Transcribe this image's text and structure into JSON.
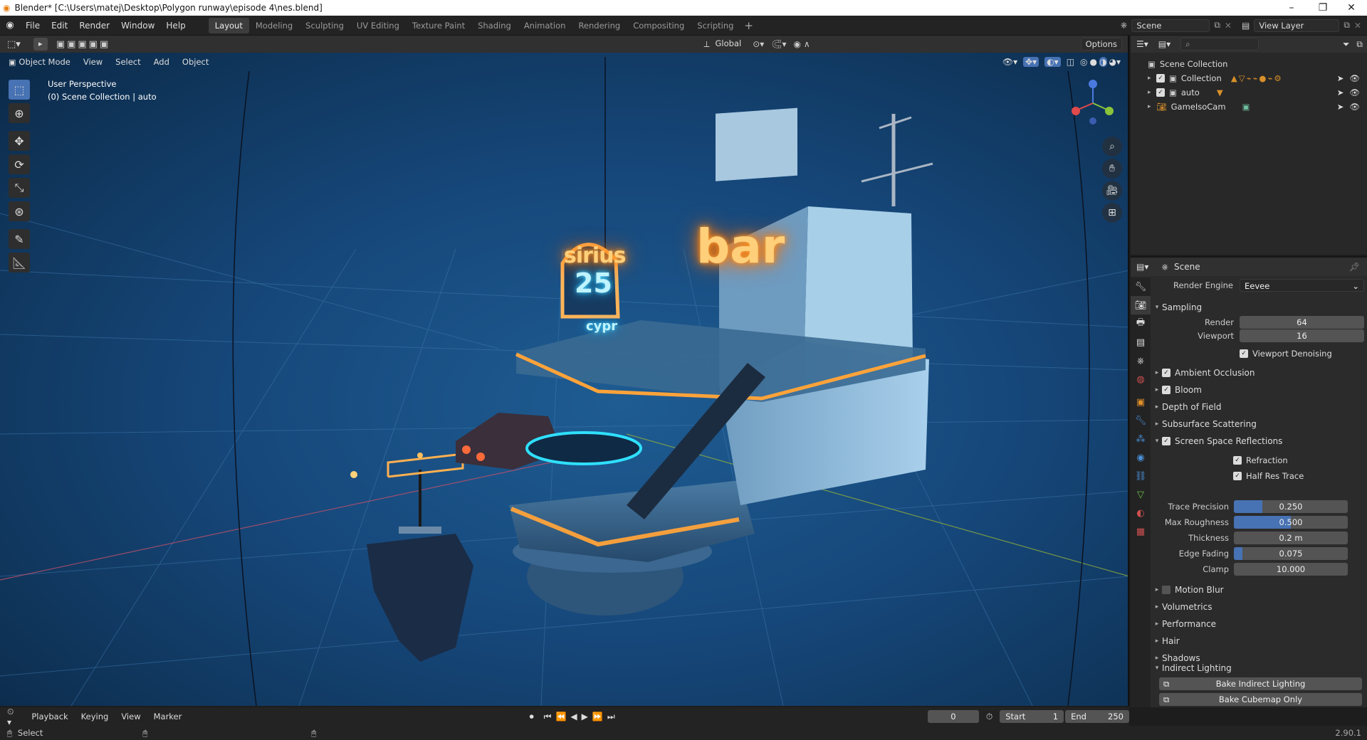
{
  "window": {
    "title": "Blender* [C:\\Users\\matej\\Desktop\\Polygon runway\\episode 4\\nes.blend]"
  },
  "menu": [
    "File",
    "Edit",
    "Render",
    "Window",
    "Help"
  ],
  "workspaces": [
    "Layout",
    "Modeling",
    "Sculpting",
    "UV Editing",
    "Texture Paint",
    "Shading",
    "Animation",
    "Rendering",
    "Compositing",
    "Scripting"
  ],
  "topbar": {
    "scene": "Scene",
    "view_layer": "View Layer"
  },
  "viewport": {
    "mode": "Object Mode",
    "menus": [
      "View",
      "Select",
      "Add",
      "Object"
    ],
    "orientation": "Global",
    "options": "Options",
    "overlay_line1": "User Perspective",
    "overlay_line2": "(0) Scene Collection | auto",
    "signs": {
      "sirius": "sirius",
      "number": "25",
      "bar": "bar",
      "cypr": "cypr"
    }
  },
  "outliner": {
    "rows": [
      {
        "label": "Scene Collection"
      },
      {
        "label": "Collection"
      },
      {
        "label": "auto"
      },
      {
        "label": "GameIsoCam"
      }
    ]
  },
  "properties": {
    "header": "Scene",
    "render_engine_label": "Render Engine",
    "render_engine": "Eevee",
    "sampling": {
      "title": "Sampling",
      "render_label": "Render",
      "render": "64",
      "viewport_label": "Viewport",
      "viewport": "16",
      "denoise": "Viewport Denoising"
    },
    "sections": {
      "ao": "Ambient Occlusion",
      "bloom": "Bloom",
      "dof": "Depth of Field",
      "sss": "Subsurface Scattering",
      "ssr": "Screen Space Reflections",
      "motion_blur": "Motion Blur",
      "volumetrics": "Volumetrics",
      "performance": "Performance",
      "hair": "Hair",
      "shadows": "Shadows",
      "indirect": "Indirect Lighting"
    },
    "ssr": {
      "refraction": "Refraction",
      "half_res": "Half Res Trace",
      "trace_precision_label": "Trace Precision",
      "trace_precision": "0.250",
      "trace_precision_frac": 0.25,
      "max_roughness_label": "Max Roughness",
      "max_roughness": "0.500",
      "max_roughness_frac": 0.5,
      "thickness_label": "Thickness",
      "thickness": "0.2 m",
      "edge_fading_label": "Edge Fading",
      "edge_fading": "0.075",
      "edge_fading_frac": 0.075,
      "clamp_label": "Clamp",
      "clamp": "10.000"
    },
    "bake_indirect": "Bake Indirect Lighting",
    "bake_cubemap": "Bake Cubemap Only"
  },
  "timeline": {
    "playback": "Playback",
    "keying": "Keying",
    "view": "View",
    "marker": "Marker",
    "frame": "0",
    "start_label": "Start",
    "start": "1",
    "end_label": "End",
    "end": "250"
  },
  "status": {
    "left": "Select",
    "version": "2.90.1"
  },
  "colors": {
    "accent": "#4772b3",
    "neon_orange": "#ff8a1a",
    "neon_cyan": "#2fd0ff"
  }
}
